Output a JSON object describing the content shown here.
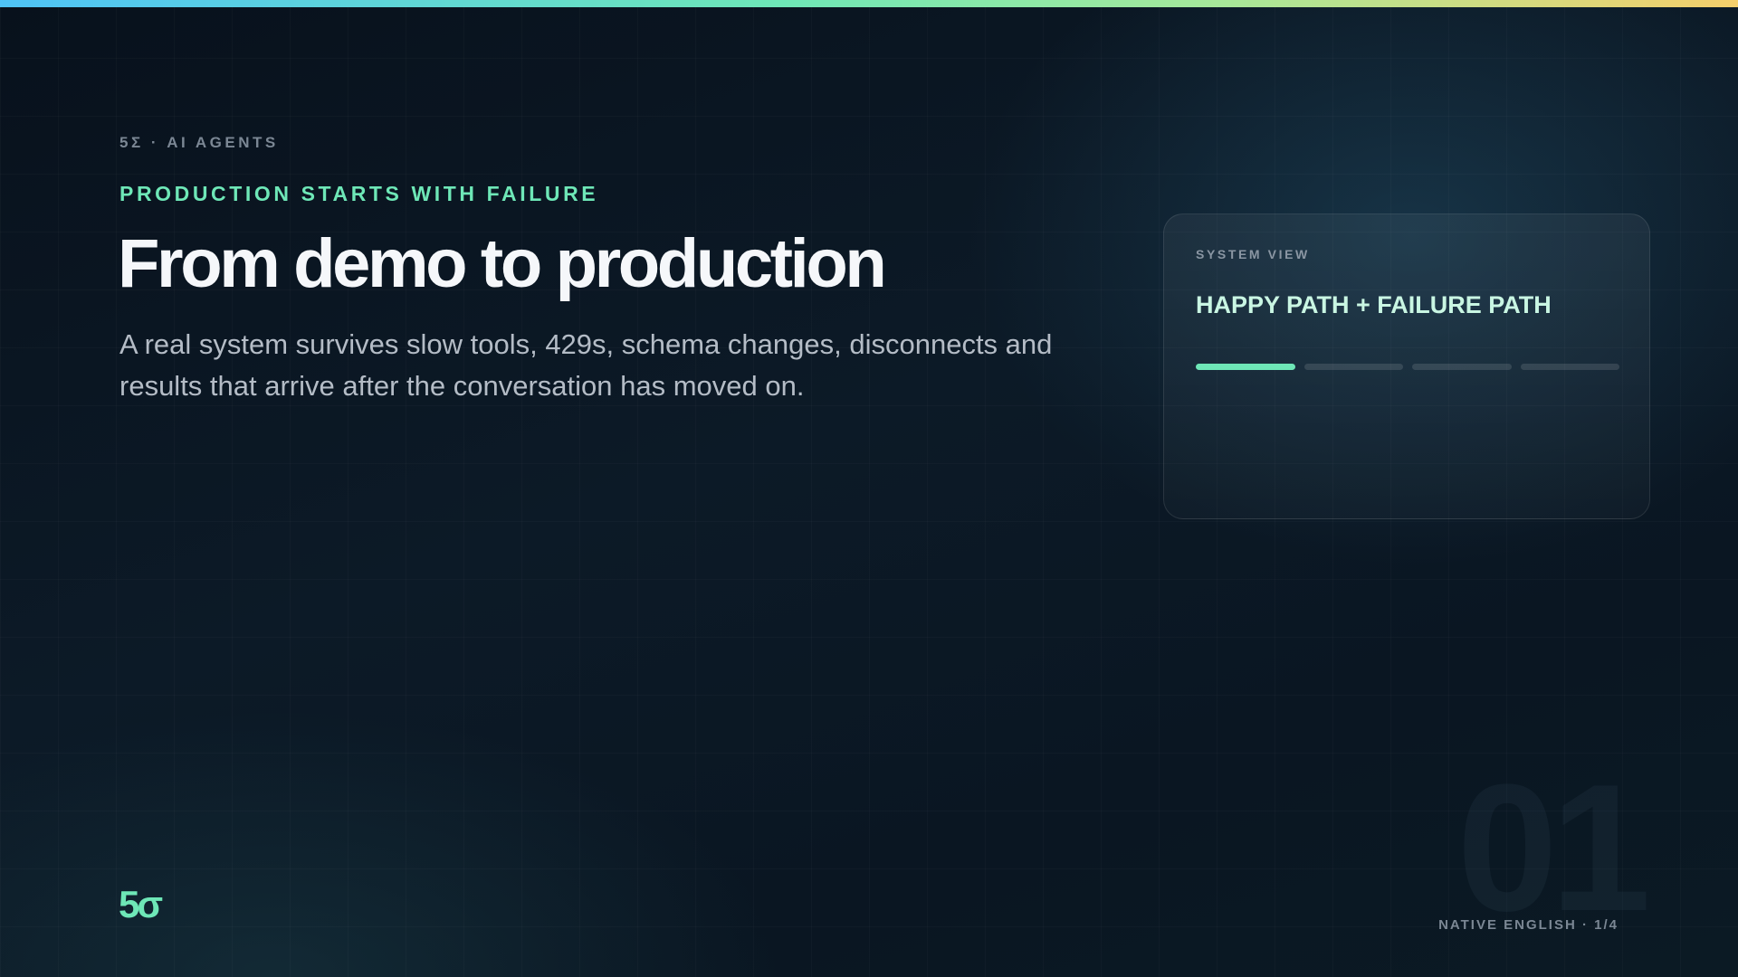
{
  "slide": {
    "kicker": "5Σ · AI AGENTS",
    "eyebrow": "PRODUCTION STARTS WITH FAILURE",
    "title": "From demo to production",
    "body": "A real system survives slow tools, 429s, schema changes, disconnects and results that arrive after the conversation has moved on."
  },
  "card": {
    "label": "SYSTEM VIEW",
    "title": "HAPPY PATH + FAILURE PATH",
    "progress": {
      "total_steps": 4,
      "active_step": 1
    }
  },
  "footer": {
    "logo": "5σ",
    "page_number": "01",
    "meta": "NATIVE ENGLISH · 1/4"
  },
  "colors": {
    "accent": "#6ee7b7",
    "background": "#08111c",
    "title": "#f5f7fa",
    "muted": "#7b8794",
    "gradient_bar": [
      "#4fc3f7",
      "#6ee7b7",
      "#f6cf6b"
    ]
  }
}
